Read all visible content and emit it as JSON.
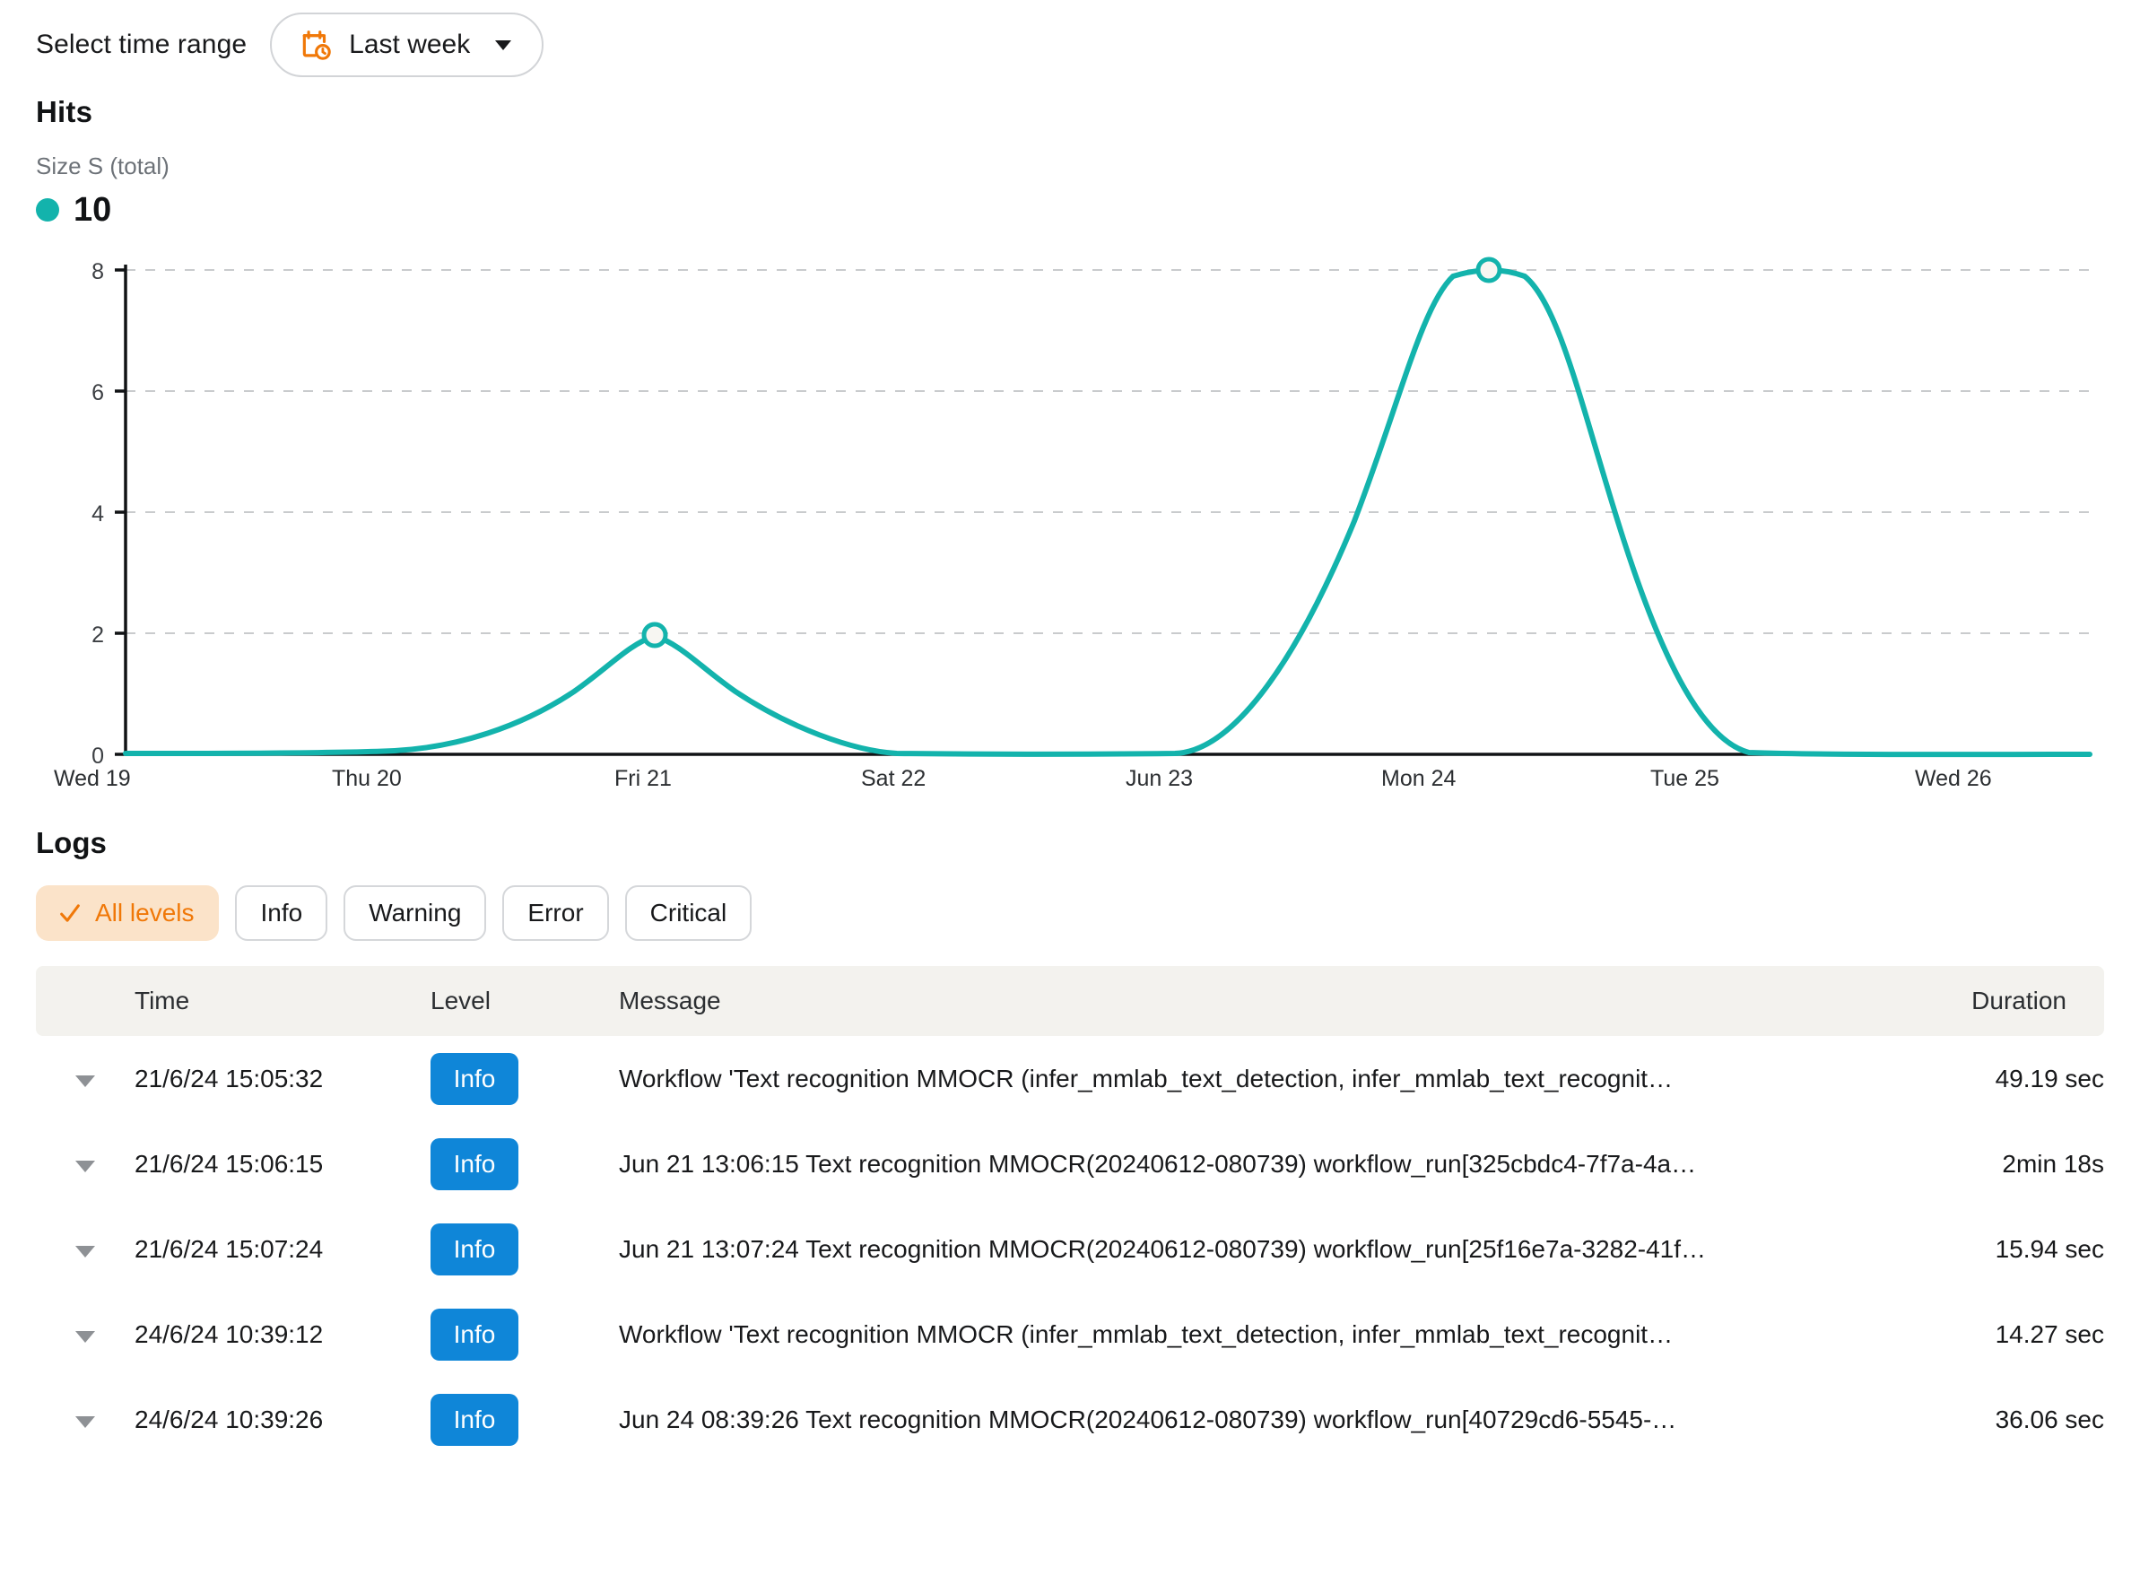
{
  "time_range": {
    "label": "Select time range",
    "value": "Last week",
    "icon": "calendar-clock-icon",
    "caret_icon": "chevron-down-icon"
  },
  "hits": {
    "title": "Hits",
    "metric_name": "Size S (total)",
    "metric_value": "10",
    "series_color": "#13b3ac"
  },
  "chart_data": {
    "type": "line",
    "title": "Hits",
    "xlabel": "",
    "ylabel": "",
    "categories": [
      "Wed 19",
      "Thu 20",
      "Fri 21",
      "Sat 22",
      "Jun 23",
      "Mon 24",
      "Tue 25",
      "Wed 26"
    ],
    "x": [
      0,
      1,
      2,
      3,
      4,
      5,
      6,
      7
    ],
    "series": [
      {
        "name": "Size S (total)",
        "color": "#13b3ac",
        "values": [
          0,
          0,
          2,
          0,
          0,
          8,
          0,
          0
        ]
      }
    ],
    "ytick_labels": [
      "0",
      "2",
      "4",
      "6",
      "8"
    ],
    "yticks": [
      0,
      2,
      4,
      6,
      8
    ],
    "ylim": [
      0,
      8
    ],
    "grid": true,
    "grid_style": "dashed-horizontal",
    "legend": "above-chart",
    "markers": [
      {
        "x": "Fri 21",
        "y": 2
      },
      {
        "x": "Mon 24",
        "y": 8
      }
    ],
    "curve": "smooth"
  },
  "logs": {
    "title": "Logs",
    "filters": [
      {
        "label": "All levels",
        "active": true,
        "icon": "check-icon"
      },
      {
        "label": "Info",
        "active": false
      },
      {
        "label": "Warning",
        "active": false
      },
      {
        "label": "Error",
        "active": false
      },
      {
        "label": "Critical",
        "active": false
      }
    ],
    "columns": {
      "time": "Time",
      "level": "Level",
      "message": "Message",
      "duration": "Duration"
    },
    "rows": [
      {
        "time": "21/6/24 15:05:32",
        "level": "Info",
        "message": "Workflow 'Text recognition MMOCR (infer_mmlab_text_detection, infer_mmlab_text_recognit…",
        "duration": "49.19 sec"
      },
      {
        "time": "21/6/24 15:06:15",
        "level": "Info",
        "message": "Jun 21 13:06:15 Text recognition MMOCR(20240612-080739) workflow_run[325cbdc4-7f7a-4a…",
        "duration": "2min 18s"
      },
      {
        "time": "21/6/24 15:07:24",
        "level": "Info",
        "message": "Jun 21 13:07:24 Text recognition MMOCR(20240612-080739) workflow_run[25f16e7a-3282-41f…",
        "duration": "15.94 sec"
      },
      {
        "time": "24/6/24 10:39:12",
        "level": "Info",
        "message": "Workflow 'Text recognition MMOCR (infer_mmlab_text_detection, infer_mmlab_text_recognit…",
        "duration": "14.27 sec"
      },
      {
        "time": "24/6/24 10:39:26",
        "level": "Info",
        "message": "Jun 24 08:39:26 Text recognition MMOCR(20240612-080739) workflow_run[40729cd6-5545-…",
        "duration": "36.06 sec"
      }
    ]
  }
}
